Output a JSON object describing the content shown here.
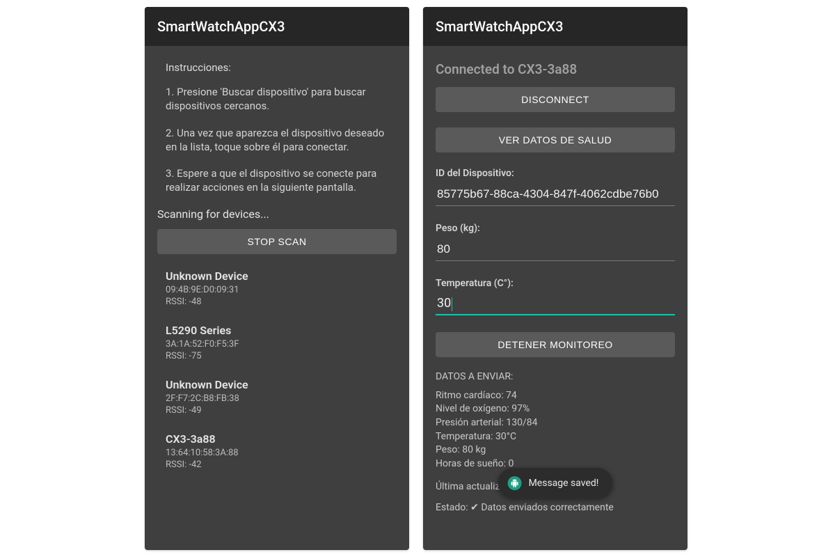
{
  "left": {
    "app_title": "SmartWatchAppCX3",
    "instructions_heading": "Instrucciones:",
    "instruction_1": "1. Presione 'Buscar dispositivo' para buscar dispositivos cercanos.",
    "instruction_2": "2. Una vez que aparezca el dispositivo deseado en la lista, toque sobre él para conectar.",
    "instruction_3": "3. Espere a que el dispositivo se conecte para realizar acciones en la siguiente pantalla.",
    "scanning_status": "Scanning for devices...",
    "stop_scan_label": "STOP SCAN",
    "devices": [
      {
        "name": "Unknown Device",
        "mac": "09:4B:9E:D0:09:31",
        "rssi": "RSSI: -48"
      },
      {
        "name": "L5290 Series",
        "mac": "3A:1A:52:F0:F5:3F",
        "rssi": "RSSI: -75"
      },
      {
        "name": "Unknown Device",
        "mac": "2F:F7:2C:B8:FB:38",
        "rssi": "RSSI: -49"
      },
      {
        "name": "CX3-3a88",
        "mac": "13:64:10:58:3A:88",
        "rssi": "RSSI: -42"
      }
    ]
  },
  "right": {
    "app_title": "SmartWatchAppCX3",
    "connected_to": "Connected to CX3-3a88",
    "disconnect_label": "DISCONNECT",
    "ver_datos_label": "VER DATOS DE SALUD",
    "id_label": "ID del Dispositivo:",
    "id_value": "85775b67-88ca-4304-847f-4062cdbe76b0",
    "peso_label": "Peso (kg):",
    "peso_value": "80",
    "temp_label": "Temperatura (C°):",
    "temp_value": "30",
    "detener_label": "DETENER MONITOREO",
    "datos_heading": "DATOS A ENVIAR:",
    "ritmo": "Ritmo cardíaco: 74",
    "oxigeno": "Nivel de oxígeno: 97%",
    "presion": "Presión arterial: 130/84",
    "temperatura": "Temperatura: 30°C",
    "peso": "Peso: 80 kg",
    "sueno": "Horas de sueño: 0",
    "ultima": "Última actualiza",
    "estado": "Estado: ✔ Datos enviados correctamente",
    "toast": "Message saved!"
  }
}
